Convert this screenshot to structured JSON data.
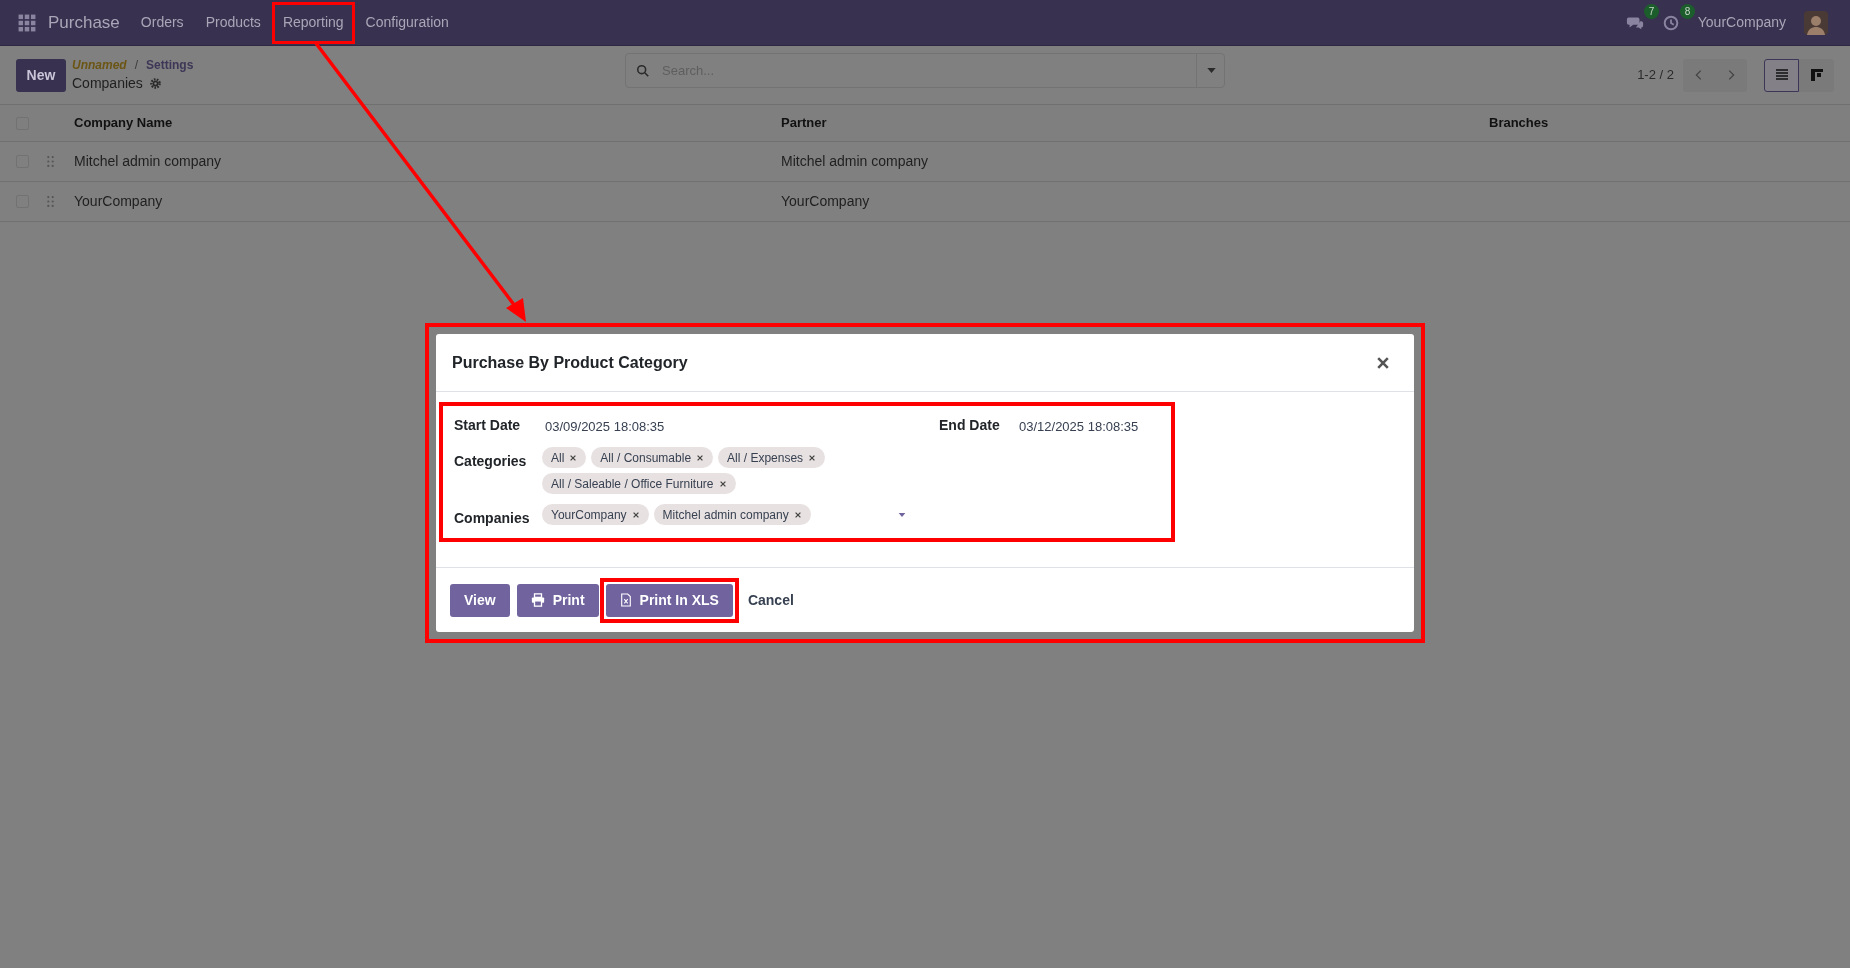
{
  "navbar": {
    "app": "Purchase",
    "menu": [
      {
        "label": "Orders",
        "highlighted": false
      },
      {
        "label": "Products",
        "highlighted": false
      },
      {
        "label": "Reporting",
        "highlighted": true
      },
      {
        "label": "Configuration",
        "highlighted": false
      }
    ],
    "messages_badge": "7",
    "activities_badge": "8",
    "company": "YourCompany"
  },
  "control_panel": {
    "new_button": "New",
    "breadcrumb": [
      "Unnamed",
      "Settings"
    ],
    "separator": "/",
    "title": "Companies",
    "search": {
      "placeholder": "Search..."
    },
    "pager": "1-2 / 2",
    "views": [
      {
        "kind": "list",
        "selected": true
      },
      {
        "kind": "kanban",
        "selected": false
      }
    ]
  },
  "table": {
    "select_all_checked": false,
    "columns": [
      "Company Name",
      "Partner",
      "Branches"
    ],
    "rows": [
      {
        "checked": false,
        "company_name": "Mitchel admin company",
        "partner": "Mitchel admin company"
      },
      {
        "checked": false,
        "company_name": "YourCompany",
        "partner": "YourCompany"
      }
    ]
  },
  "dialog": {
    "title": "Purchase By Product Category",
    "highlighted": true,
    "form": {
      "highlighted": true,
      "start_date": {
        "label": "Start Date",
        "value": "03/09/2025 18:08:35"
      },
      "end_date": {
        "label": "End Date",
        "value": "03/12/2025 18:08:35"
      },
      "categories": {
        "label": "Categories",
        "tags": [
          "All",
          "All / Consumable",
          "All / Expenses",
          "All / Saleable / Office Furniture"
        ]
      },
      "companies": {
        "label": "Companies",
        "tags": [
          "YourCompany",
          "Mitchel admin company"
        ]
      }
    },
    "buttons": [
      {
        "label": "View",
        "kind": "view",
        "highlighted": false
      },
      {
        "label": "Print",
        "kind": "print",
        "highlighted": false
      },
      {
        "label": "Print In XLS",
        "kind": "xls",
        "highlighted": true
      },
      {
        "label": "Cancel",
        "kind": "cancel",
        "highlighted": false
      }
    ]
  }
}
